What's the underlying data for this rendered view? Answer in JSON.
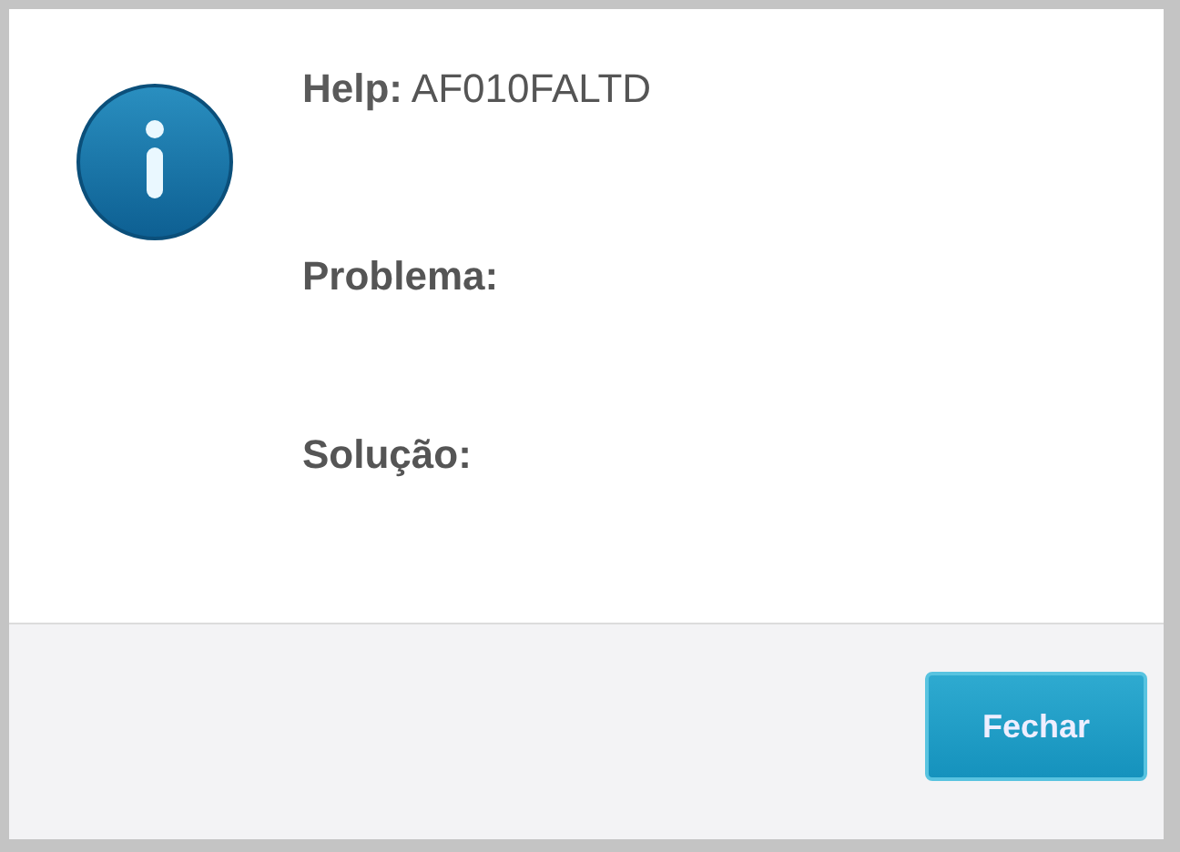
{
  "dialog": {
    "heading": "**Help:** AF010FALTD",
    "fields": [
      "Problema:",
      "Solução:"
    ],
    "buttons": [
      "Fechar"
    ]
  }
}
